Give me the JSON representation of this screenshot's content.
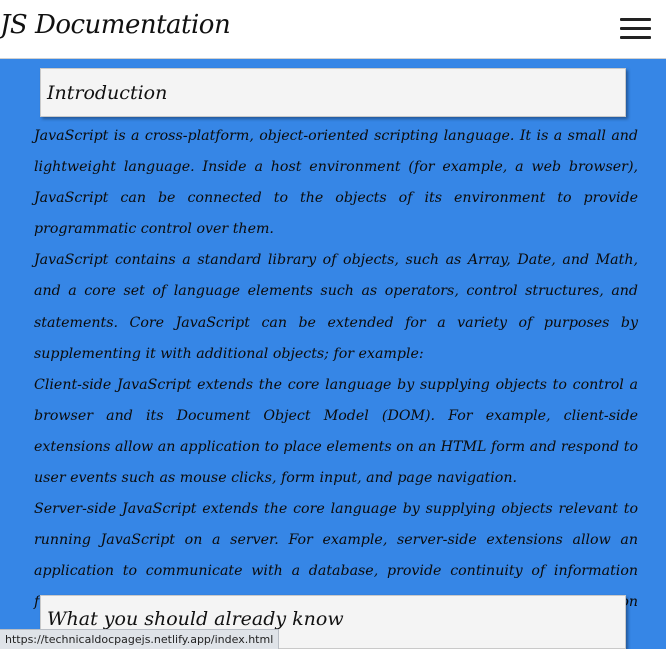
{
  "header": {
    "title": "JS Documentation",
    "menu_icon": "hamburger-menu-icon"
  },
  "main": {
    "section_intro": {
      "title": "Introduction",
      "paragraphs": [
        "JavaScript is a cross-platform, object-oriented scripting language. It is a small and lightweight language. Inside a host environment (for example, a web browser), JavaScript can be connected to the objects of its environment to provide programmatic control over them.",
        "JavaScript contains a standard library of objects, such as Array, Date, and Math, and a core set of language elements such as operators, control structures, and statements. Core JavaScript can be extended for a variety of purposes by supplementing it with additional objects; for example:",
        "Client-side JavaScript extends the core language by supplying objects to control a browser and its Document Object Model (DOM). For example, client-side extensions allow an application to place elements on an HTML form and respond to user events such as mouse clicks, form input, and page navigation.",
        "Server-side JavaScript extends the core language by supplying objects relevant to running JavaScript on a server. For example, server-side extensions allow an application to communicate with a database, provide continuity of information from one invocation to another of the application, or perform file manipulations on a server."
      ]
    },
    "section_know": {
      "title": "What you should already know"
    }
  },
  "status_bar": {
    "url": "https://technicaldocpagejs.netlify.app/index.html"
  },
  "colors": {
    "main_background": "#3686e6",
    "header_background": "#ffffff",
    "section_header_background": "#f4f4f4"
  }
}
